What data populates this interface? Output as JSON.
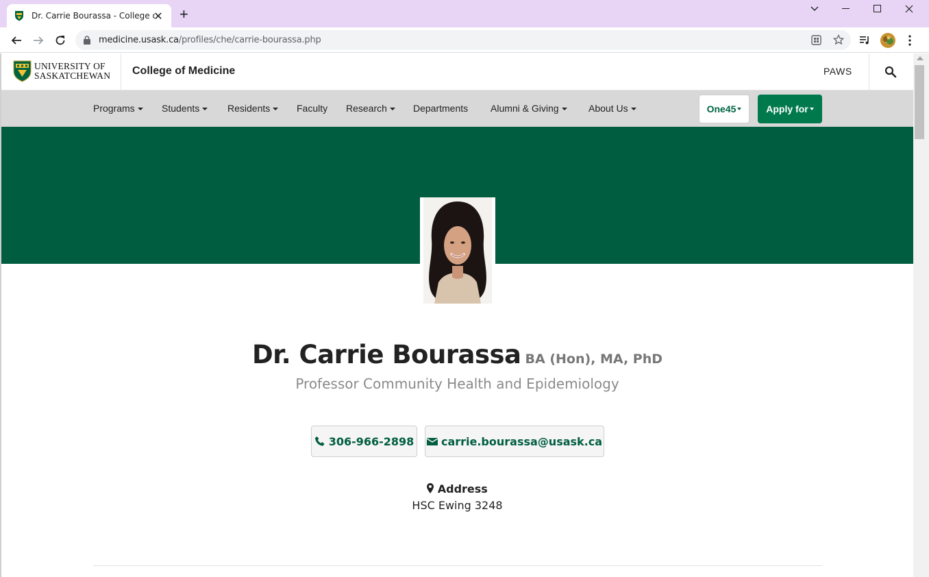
{
  "browser": {
    "tab_title": "Dr. Carrie Bourassa - College of Medicine",
    "url_host": "medicine.usask.ca",
    "url_path": "/profiles/che/carrie-bourassa.php"
  },
  "header": {
    "logo_line1": "UNIVERSITY OF",
    "logo_line2": "SASKATCHEWAN",
    "college_name": "College of Medicine",
    "paws_label": "PAWS"
  },
  "nav": {
    "items": [
      {
        "label": "Programs",
        "dropdown": true
      },
      {
        "label": "Students",
        "dropdown": true
      },
      {
        "label": "Residents",
        "dropdown": true
      },
      {
        "label": "Faculty",
        "dropdown": false
      },
      {
        "label": "Research",
        "dropdown": true
      },
      {
        "label": "Departments",
        "dropdown": false
      },
      {
        "label": "Alumni & Giving",
        "dropdown": true
      },
      {
        "label": "About Us",
        "dropdown": true
      }
    ],
    "one45_label": "One45",
    "apply_label": "Apply for"
  },
  "profile": {
    "name": "Dr. Carrie Bourassa",
    "credentials": "BA (Hon), MA, PhD",
    "position": "Professor Community Health and Epidemiology",
    "phone": "306-966-2898",
    "email": "carrie.bourassa@usask.ca",
    "address_label": "Address",
    "address": "HSC Ewing 3248"
  },
  "colors": {
    "brand_green": "#005d40",
    "apply_green": "#007a4d",
    "nav_bg": "#d8d8d8",
    "tabbar_bg": "#e8d5f6"
  }
}
